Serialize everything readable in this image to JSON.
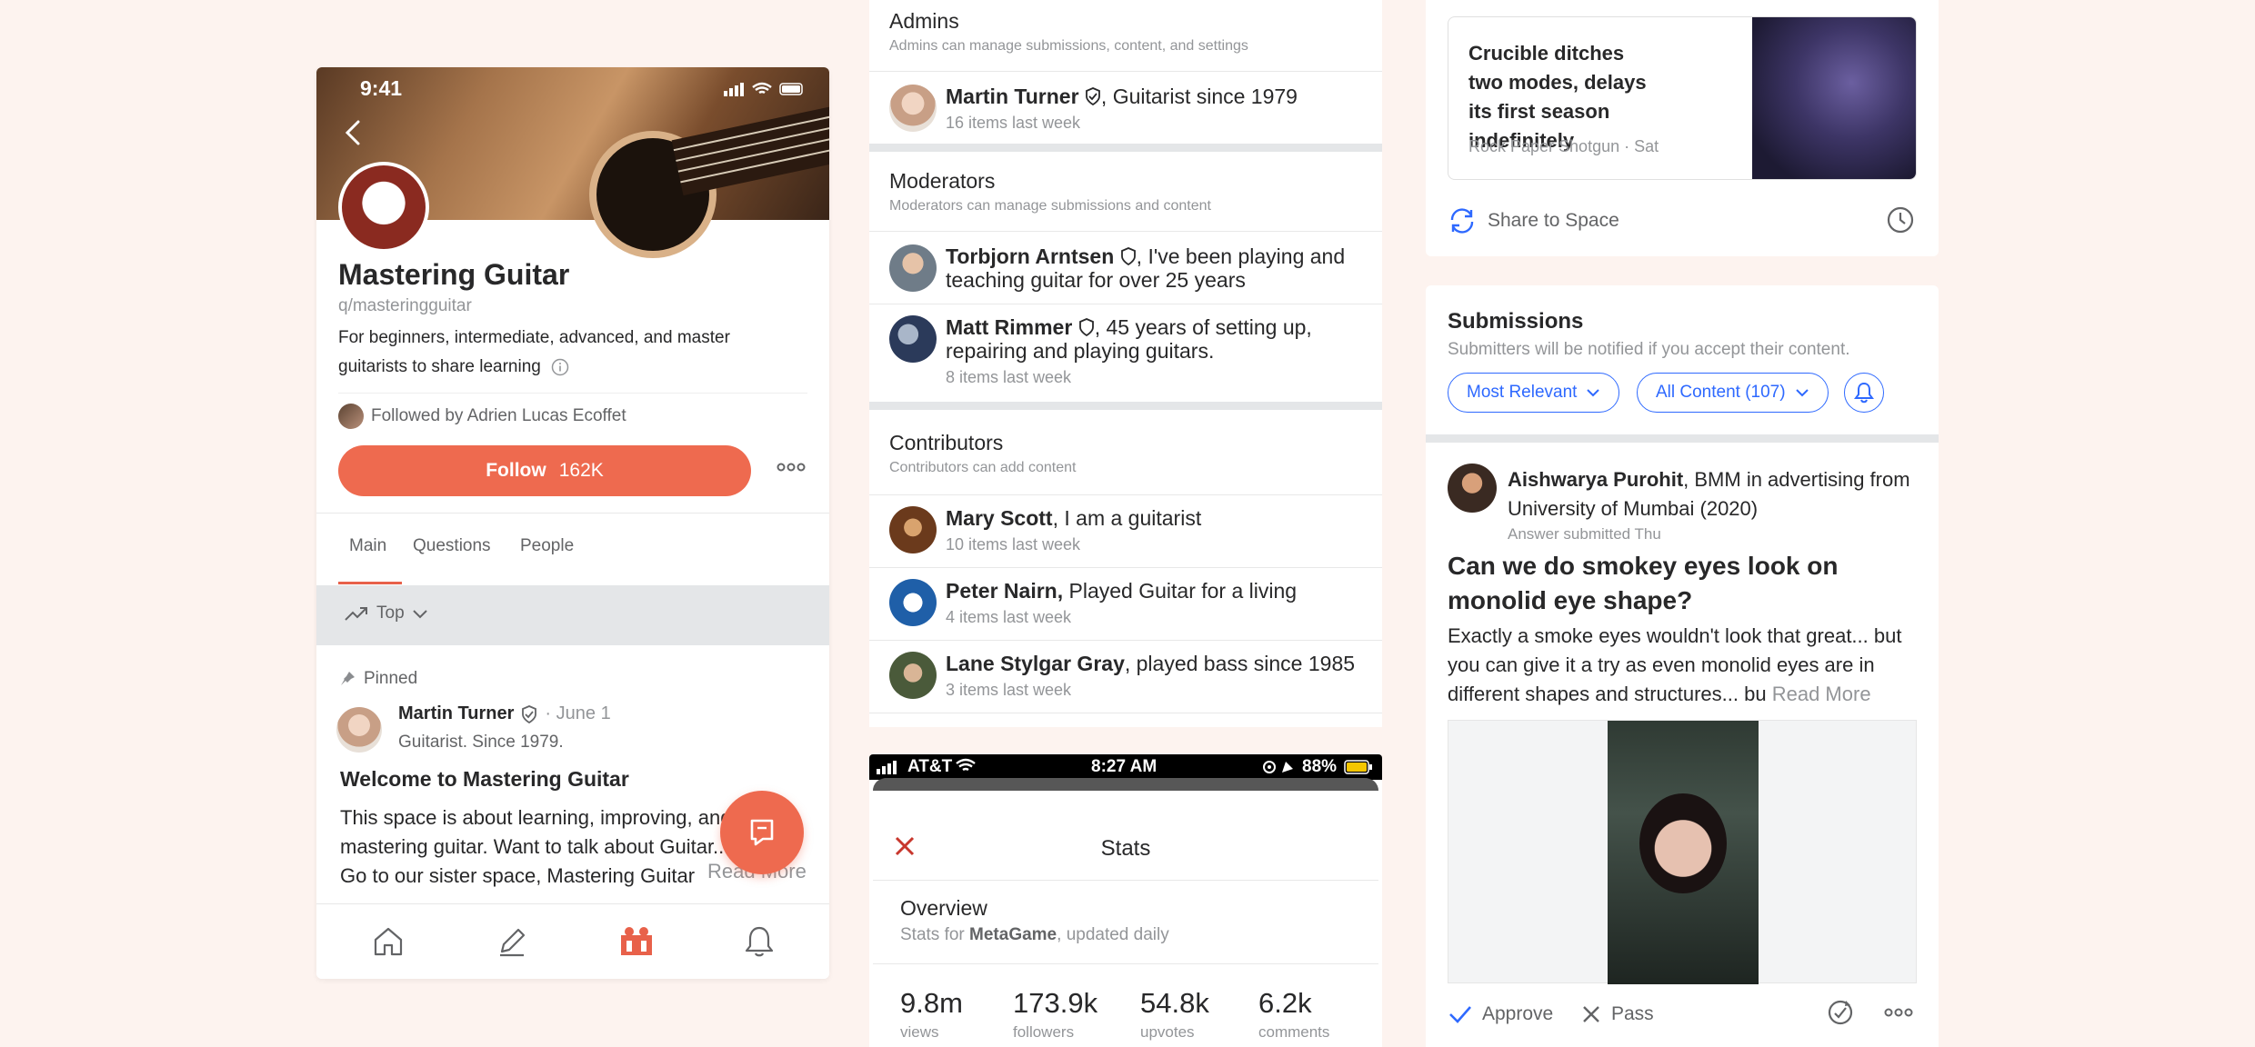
{
  "space": {
    "status_time": "9:41",
    "name": "Mastering Guitar",
    "handle": "q/masteringguitar",
    "description": "For beginners, intermediate, advanced, and master guitarists to share learning",
    "followed_by": "Followed by Adrien Lucas Ecoffet",
    "follow_label": "Follow",
    "follow_count": "162K",
    "tabs": [
      {
        "label": "Main",
        "active": true
      },
      {
        "label": "Questions",
        "active": false
      },
      {
        "label": "People",
        "active": false
      }
    ],
    "sort_label": "Top",
    "pinned_label": "Pinned",
    "post": {
      "author": "Martin Turner",
      "date": "· June 1",
      "credential": "Guitarist. Since 1979.",
      "title": "Welcome to Mastering Guitar",
      "body_lines": [
        "This space is about learning, improving, and",
        "mastering guitar. Want to talk about Guitar...",
        "Go to our sister space, Mastering Guitar"
      ],
      "read_more": "Read More"
    },
    "accent_color": "#EE6A4F"
  },
  "people": {
    "admins": {
      "title": "Admins",
      "subtitle": "Admins can manage submissions, content, and settings",
      "members": [
        {
          "name": "Martin Turner",
          "cred": ", Guitarist since 1979",
          "activity": "16 items last week"
        }
      ]
    },
    "moderators": {
      "title": "Moderators",
      "subtitle": "Moderators can manage submissions and content",
      "members": [
        {
          "name": "Torbjorn Arntsen",
          "cred_line1": ", I've been playing and",
          "cred_line2": "teaching guitar for over 25 years"
        },
        {
          "name": "Matt Rimmer",
          "cred_line1": ", 45 years of setting up,",
          "cred_line2": "repairing and playing guitars.",
          "activity": "8 items last week"
        }
      ]
    },
    "contributors": {
      "title": "Contributors",
      "subtitle": "Contributors can add content",
      "members": [
        {
          "name": "Mary Scott",
          "cred": ", I am a guitarist",
          "activity": "10 items last week"
        },
        {
          "name": "Peter Nairn,",
          "cred": " Played Guitar for a living",
          "activity": "4 items last week"
        },
        {
          "name": "Lane Stylgar Gray",
          "cred": ", played bass since 1985",
          "activity": "3 items last week"
        }
      ]
    }
  },
  "stats": {
    "carrier": "AT&T",
    "time": "8:27 AM",
    "battery": "88%",
    "title": "Stats",
    "overview_title": "Overview",
    "overview_prefix": "Stats for ",
    "overview_space": "MetaGame",
    "overview_suffix": ", updated daily",
    "items": [
      {
        "value": "9.8m",
        "label": "views"
      },
      {
        "value": "173.9k",
        "label": "followers"
      },
      {
        "value": "54.8k",
        "label": "upvotes"
      },
      {
        "value": "6.2k",
        "label": "comments"
      }
    ]
  },
  "news": {
    "title": "Crucible ditches two modes, delays its first season indefinitely",
    "source": "Rock Paper Shotgun · Sat",
    "share_label": "Share to Space"
  },
  "submissions": {
    "title": "Submissions",
    "subtitle": "Submitters will be notified if you accept their content.",
    "filter_relevance": "Most Relevant",
    "filter_content": "All Content (107)",
    "answer": {
      "author": "Aishwarya Purohit",
      "cred": ", BMM in advertising from University of Mumbai (2020)",
      "meta": "Answer submitted Thu",
      "question": "Can we do smokey eyes look on monolid eye shape?",
      "body": "Exactly a smoke eyes wouldn't look that great... but you can give it a try as even monolid eyes are in different shapes and structures... bu",
      "read_more": "Read More"
    },
    "approve_label": "Approve",
    "pass_label": "Pass",
    "link_color": "#2E69FF"
  }
}
